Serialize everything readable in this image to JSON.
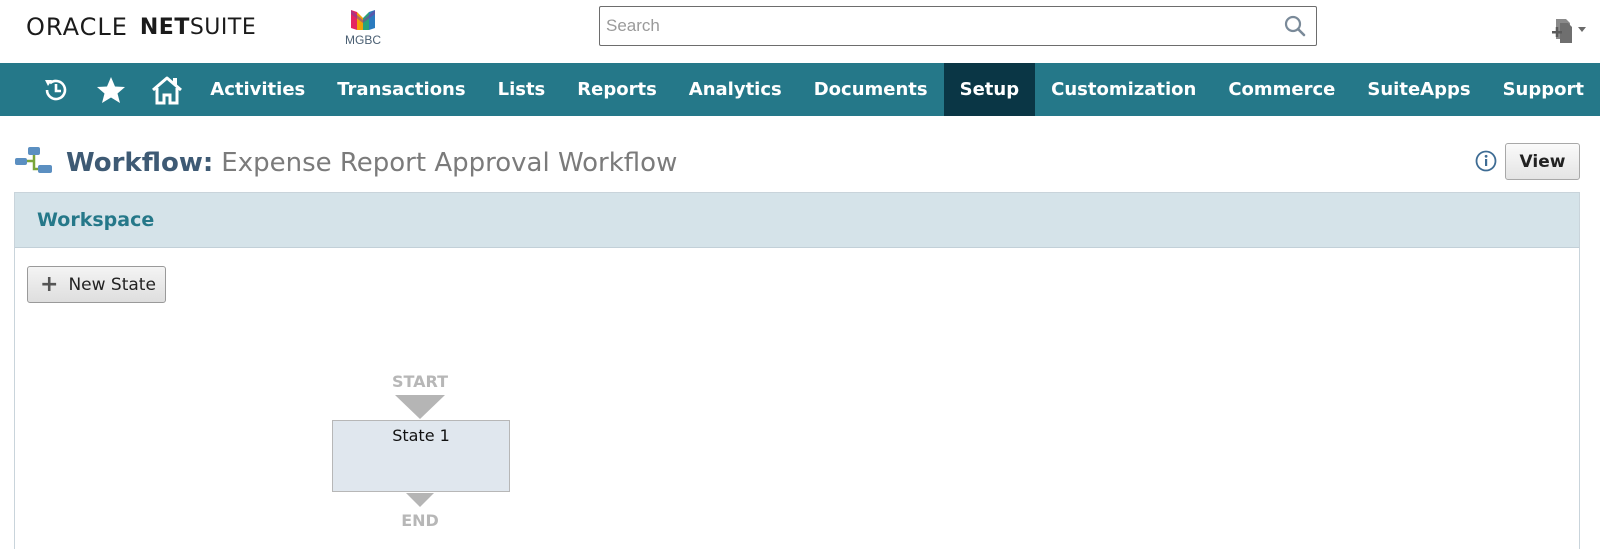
{
  "brand": {
    "oracle": "ORACLE",
    "net": "NET",
    "suite": "SUITE"
  },
  "company": {
    "name": "MGBC",
    "logo_icon": "mgbc-logo-icon"
  },
  "search": {
    "placeholder": "Search",
    "value": ""
  },
  "nav": {
    "icons": [
      "recent-icon",
      "favorites-star-icon",
      "home-icon"
    ],
    "items": [
      "Activities",
      "Transactions",
      "Lists",
      "Reports",
      "Analytics",
      "Documents",
      "Setup",
      "Customization",
      "Commerce",
      "SuiteApps",
      "Support"
    ],
    "active": "Setup"
  },
  "page": {
    "record_type": "Workflow:",
    "record_name": "Expense Report Approval Workflow",
    "view_button": "View"
  },
  "workspace": {
    "title": "Workspace",
    "new_state_button": "New State",
    "diagram": {
      "start_label": "START",
      "end_label": "END",
      "states": [
        "State 1"
      ]
    }
  },
  "colors": {
    "nav_bg": "#257889",
    "nav_active": "#0a3645",
    "panel_header": "#d5e3e9",
    "state_fill": "#e0e7ee"
  }
}
